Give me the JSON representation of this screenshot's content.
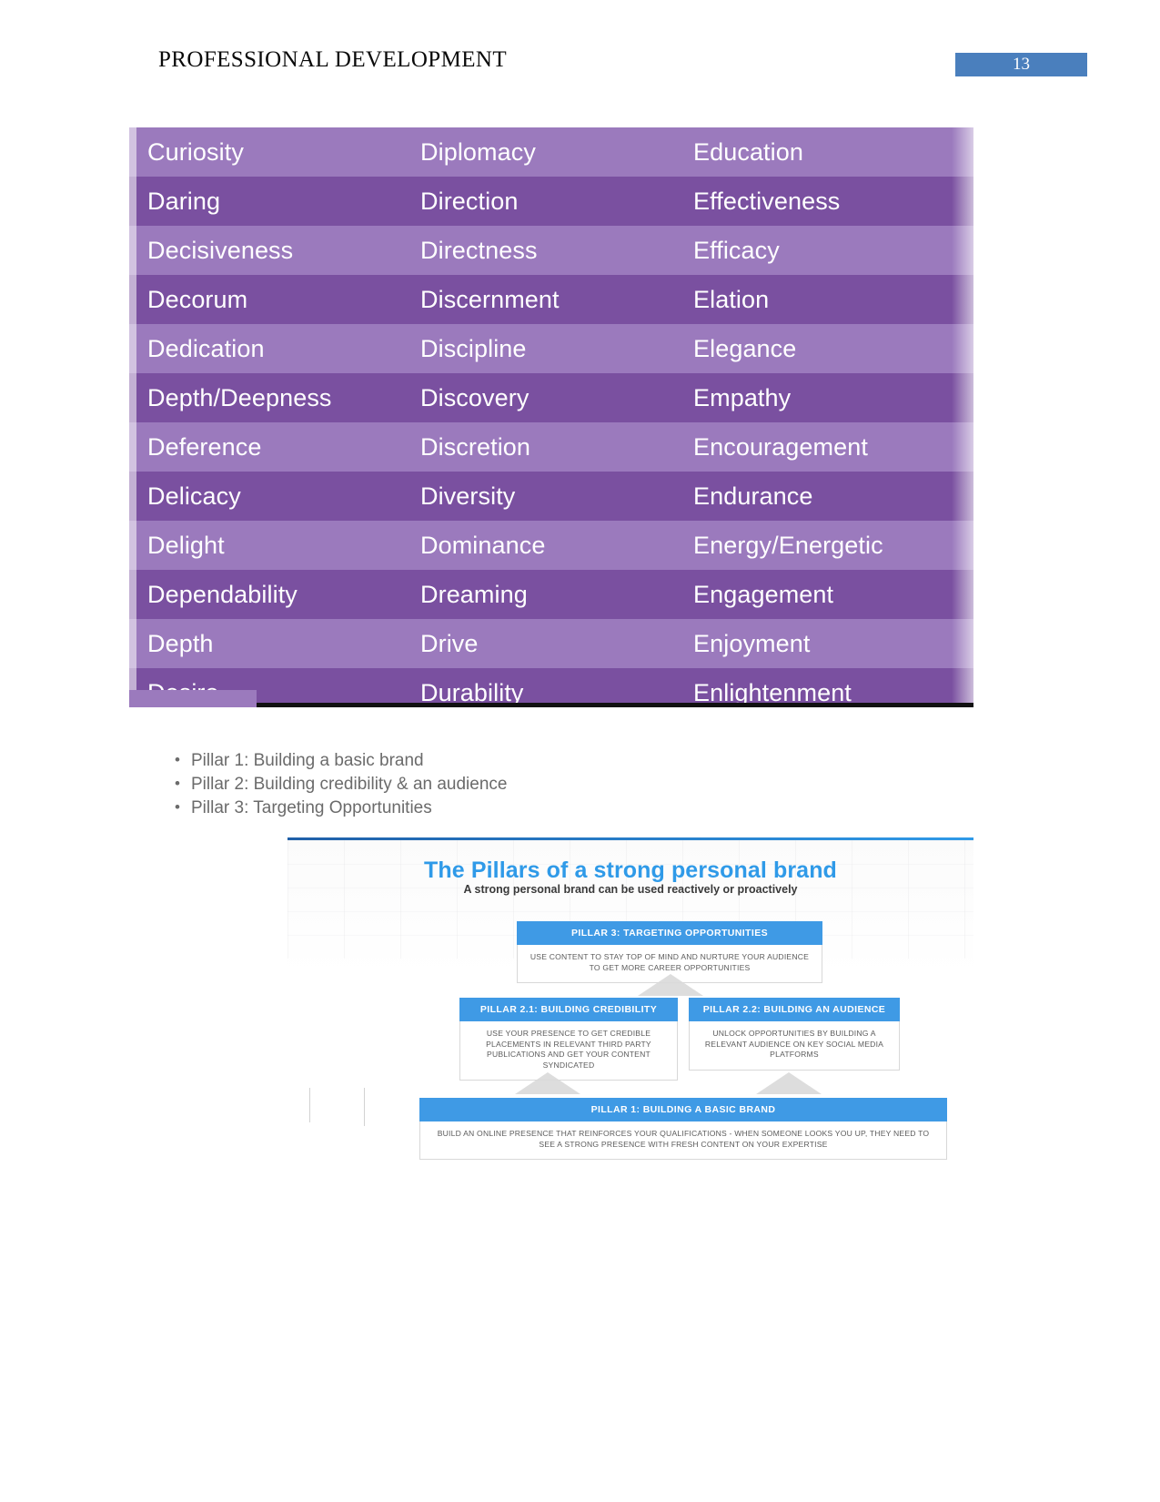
{
  "header": {
    "title": "PROFESSIONAL DEVELOPMENT",
    "page_number": "13",
    "badge_color": "#4a7fbd"
  },
  "word_table": {
    "row_light_color": "#9b7abd",
    "row_dark_color": "#7a50a0",
    "text_color": "#ffffff",
    "rows": [
      {
        "shade": "light",
        "cells": [
          "Curiosity",
          "Diplomacy",
          "Education"
        ]
      },
      {
        "shade": "dark",
        "cells": [
          "Daring",
          "Direction",
          "Effectiveness"
        ]
      },
      {
        "shade": "light",
        "cells": [
          "Decisiveness",
          "Directness",
          "Efficacy"
        ]
      },
      {
        "shade": "dark",
        "cells": [
          "Decorum",
          "Discernment",
          "Elation"
        ]
      },
      {
        "shade": "light",
        "cells": [
          "Dedication",
          "Discipline",
          "Elegance"
        ]
      },
      {
        "shade": "dark",
        "cells": [
          "Depth/Deepness",
          "Discovery",
          "Empathy"
        ]
      },
      {
        "shade": "light",
        "cells": [
          "Deference",
          "Discretion",
          "Encouragement"
        ]
      },
      {
        "shade": "dark",
        "cells": [
          "Delicacy",
          "Diversity",
          "Endurance"
        ]
      },
      {
        "shade": "light",
        "cells": [
          "Delight",
          "Dominance",
          "Energy/Energetic"
        ]
      },
      {
        "shade": "dark",
        "cells": [
          "Dependability",
          "Dreaming",
          "Engagement"
        ]
      },
      {
        "shade": "light",
        "cells": [
          "Depth",
          "Drive",
          "Enjoyment"
        ]
      },
      {
        "shade": "dark",
        "cells": [
          "Desire",
          "Durability",
          "Enlightenment"
        ]
      }
    ]
  },
  "bullets": {
    "items": [
      "Pillar 1: Building a basic brand",
      "Pillar 2: Building credibility & an audience",
      "Pillar 3: Targeting Opportunities"
    ]
  },
  "infographic": {
    "accent_color": "#3f9ae5",
    "title": "The Pillars of a strong personal brand",
    "subtitle": "A strong personal brand can be used reactively or proactively",
    "pillar3": {
      "heading": "PILLAR 3: TARGETING OPPORTUNITIES",
      "body": "USE CONTENT TO STAY TOP OF MIND AND NURTURE YOUR AUDIENCE TO GET MORE CAREER OPPORTUNITIES"
    },
    "pillar21": {
      "heading": "PILLAR 2.1: BUILDING CREDIBILITY",
      "body": "USE YOUR  PRESENCE TO GET CREDIBLE PLACEMENTS IN RELEVANT THIRD PARTY PUBLICATIONS AND GET YOUR CONTENT SYNDICATED"
    },
    "pillar22": {
      "heading": "PILLAR 2.2: BUILDING AN AUDIENCE",
      "body": "UNLOCK OPPORTUNITIES BY BUILDING A RELEVANT AUDIENCE ON KEY SOCIAL MEDIA PLATFORMS"
    },
    "pillar1": {
      "heading": "PILLAR 1: BUILDING A BASIC BRAND",
      "body": "BUILD AN ONLINE PRESENCE THAT REINFORCES YOUR QUALIFICATIONS - WHEN SOMEONE LOOKS YOU UP, THEY NEED TO SEE A STRONG PRESENCE WITH FRESH CONTENT ON YOUR EXPERTISE"
    }
  }
}
